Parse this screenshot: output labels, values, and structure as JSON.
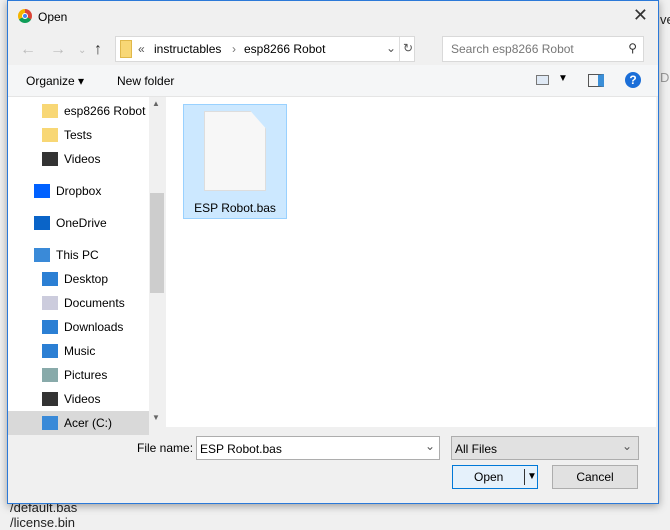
{
  "background": {
    "lines": [
      "/default.bas",
      "/license.bin"
    ],
    "right_fragments": [
      "ve",
      "Dr"
    ]
  },
  "title": "Open",
  "address": {
    "overflow": "«",
    "crumbs": [
      "instructables",
      "esp8266 Robot"
    ]
  },
  "search": {
    "placeholder": "Search esp8266 Robot"
  },
  "toolbar": {
    "organize": "Organize",
    "new_folder": "New folder"
  },
  "sidebar": [
    {
      "label": "esp8266 Robot",
      "icon": "folder-icon"
    },
    {
      "label": "Tests",
      "icon": "user-folder-icon"
    },
    {
      "label": "Videos",
      "icon": "video-icon"
    },
    {
      "label": "Dropbox",
      "icon": "dropbox-icon"
    },
    {
      "label": "OneDrive",
      "icon": "cloud-icon"
    },
    {
      "label": "This PC",
      "icon": "computer-icon"
    },
    {
      "label": "Desktop",
      "icon": "desktop-icon"
    },
    {
      "label": "Documents",
      "icon": "documents-icon"
    },
    {
      "label": "Downloads",
      "icon": "download-icon"
    },
    {
      "label": "Music",
      "icon": "music-icon"
    },
    {
      "label": "Pictures",
      "icon": "pictures-icon"
    },
    {
      "label": "Videos",
      "icon": "video-icon"
    },
    {
      "label": "Acer (C:)",
      "icon": "drive-icon"
    }
  ],
  "files": [
    {
      "name": "ESP Robot.bas",
      "selected": true
    }
  ],
  "footer": {
    "file_name_label": "File name:",
    "file_name_value": "ESP Robot.bas",
    "filter": "All Files",
    "open": "Open",
    "cancel": "Cancel"
  },
  "colors": {
    "accent": "#2b79d8",
    "selection": "#cce8ff"
  }
}
